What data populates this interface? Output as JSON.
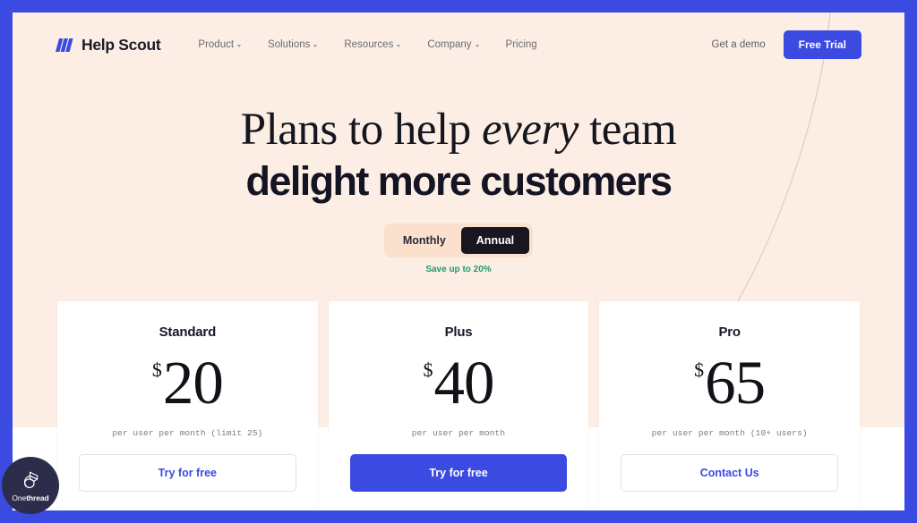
{
  "theme": {
    "frame_color": "#3b4ae0",
    "hero_bg": "#fceee4",
    "accent_blue": "#3b4ae0",
    "toggle_bg": "#fae0cd",
    "toggle_active_bg": "#17171f",
    "save_note_color": "#1f9a6e",
    "card_bg": "#ffffff"
  },
  "nav": {
    "brand": "Help Scout",
    "brand_mark": "help-scout-slashes-logo",
    "links": [
      {
        "label": "Product",
        "has_caret": true
      },
      {
        "label": "Solutions",
        "has_caret": true
      },
      {
        "label": "Resources",
        "has_caret": true
      },
      {
        "label": "Company",
        "has_caret": true
      },
      {
        "label": "Pricing",
        "has_caret": false
      }
    ],
    "demo_label": "Get a demo",
    "trial_label": "Free Trial"
  },
  "hero": {
    "line1_before": "Plans to help ",
    "line1_emphasis": "every",
    "line1_after": " team",
    "line2": "delight more customers"
  },
  "billing_toggle": {
    "options": [
      {
        "label": "Monthly",
        "active": false
      },
      {
        "label": "Annual",
        "active": true
      }
    ],
    "save_note": "Save up to 20%"
  },
  "plans": [
    {
      "name": "Standard",
      "currency": "$",
      "amount": "20",
      "note": "per user per month (limit 25)",
      "cta_label": "Try for free",
      "cta_style": "outline"
    },
    {
      "name": "Plus",
      "currency": "$",
      "amount": "40",
      "note": "per user per month",
      "cta_label": "Try for free",
      "cta_style": "filled"
    },
    {
      "name": "Pro",
      "currency": "$",
      "amount": "65",
      "note": "per user per month (10+ users)",
      "cta_label": "Contact Us",
      "cta_style": "outline"
    }
  ],
  "watermark": {
    "name_light": "One",
    "name_bold": "thread",
    "icon": "onethread-isometric-logo"
  }
}
